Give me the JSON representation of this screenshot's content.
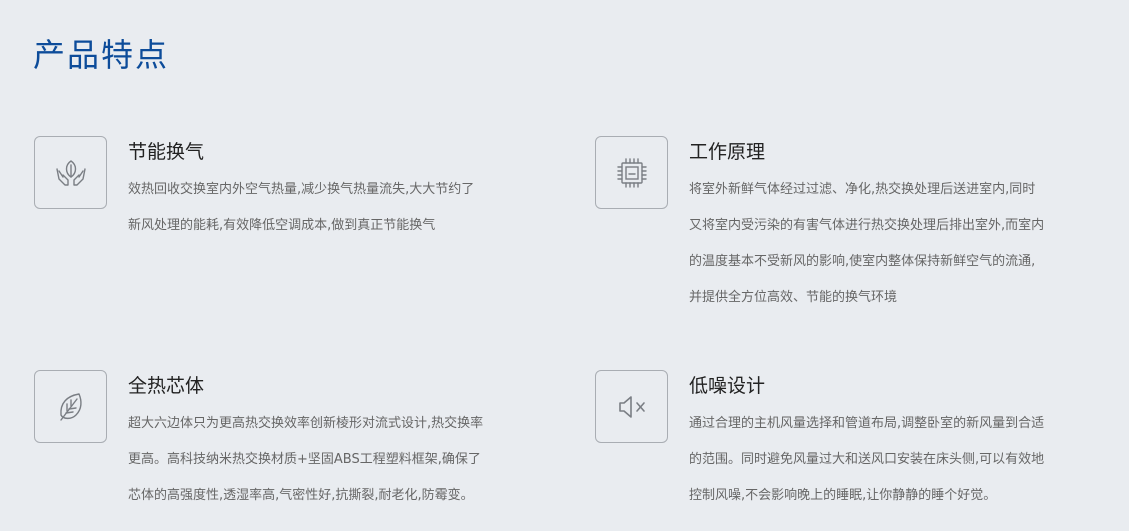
{
  "page": {
    "title": "产品特点"
  },
  "features": [
    {
      "icon": "hands-leaf-icon",
      "title": "节能换气",
      "lines": [
        "效热回收交换室内外空气热量,减少换气热量流失,大大节约了",
        "新风处理的能耗,有效降低空调成本,做到真正节能换气"
      ]
    },
    {
      "icon": "chip-icon",
      "title": "工作原理",
      "lines": [
        "将室外新鲜气体经过过滤、净化,热交换处理后送进室内,同时",
        "又将室内受污染的有害气体进行热交换处理后排出室外,而室内",
        "的温度基本不受新风的影响,使室内整体保持新鲜空气的流通,",
        "并提供全方位高效、节能的换气环境"
      ]
    },
    {
      "icon": "leaf-icon",
      "title": "全热芯体",
      "lines": [
        "超大六边体只为更高热交换效率创新棱形对流式设计,热交换率",
        "更高。高科技纳米热交换材质+坚固ABS工程塑料框架,确保了",
        "芯体的高强度性,透湿率高,气密性好,抗撕裂,耐老化,防霉变。"
      ]
    },
    {
      "icon": "speaker-mute-icon",
      "title": "低噪设计",
      "lines": [
        "通过合理的主机风量选择和管道布局,调整卧室的新风量到合适",
        "的范围。同时避免风量过大和送风口安装在床头侧,可以有效地",
        "控制风噪,不会影响晚上的睡眠,让你静静的睡个好觉。"
      ]
    }
  ],
  "colors": {
    "background": "#e9ecf0",
    "title": "#0d4c9a",
    "icon_stroke": "#7a7e84"
  }
}
